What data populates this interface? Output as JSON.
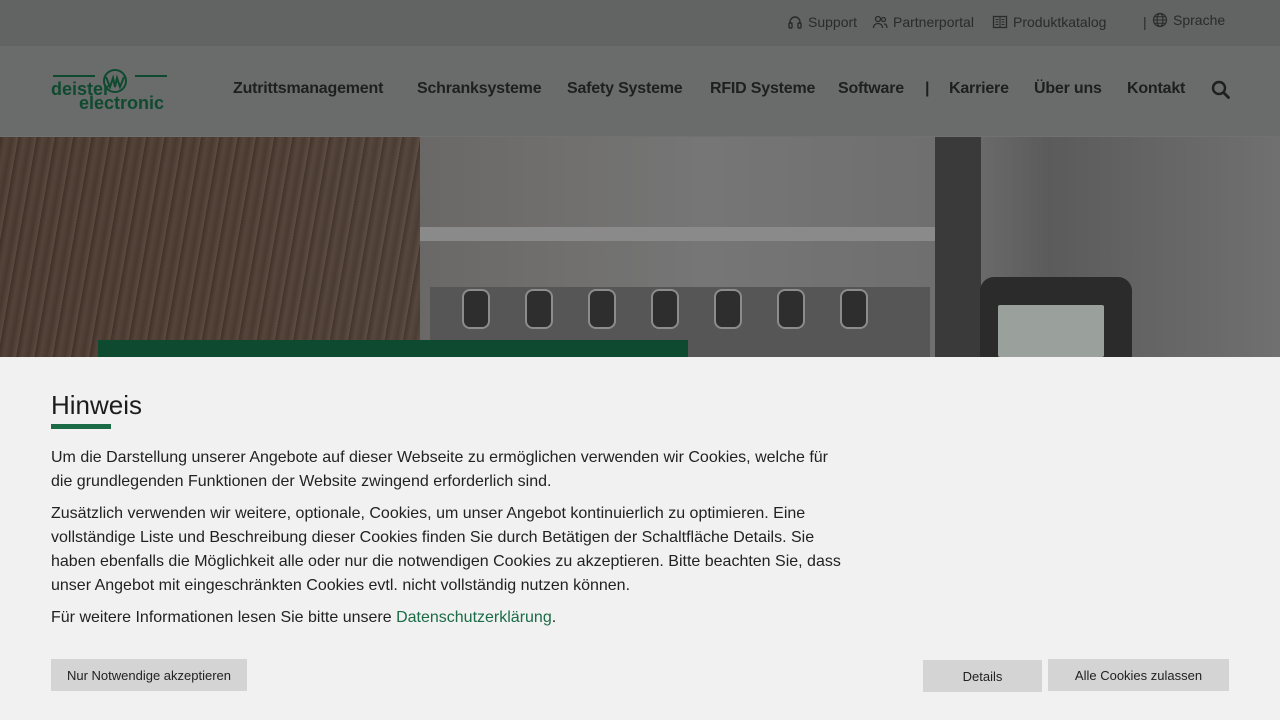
{
  "topbar": {
    "support": "Support",
    "partnerportal": "Partnerportal",
    "produktkatalog": "Produktkatalog",
    "separator": "|",
    "sprache": "Sprache"
  },
  "logo": {
    "line1": "deister",
    "line2": "electronic"
  },
  "nav": {
    "items": [
      "Zutrittsmanagement",
      "Schranksysteme",
      "Safety Systeme",
      "RFID Systeme",
      "Software",
      "Karriere",
      "Über uns",
      "Kontakt"
    ],
    "separator": "|"
  },
  "cookie": {
    "title": "Hinweis",
    "p1": "Um die Darstellung unserer Angebote auf dieser Webseite zu ermöglichen verwenden wir Cookies, welche für die grundlegenden Funktionen der Website zwingend erforderlich sind.",
    "p2": "Zusätzlich verwenden wir weitere, optionale, Cookies, um unser Angebot kontinuierlich zu optimieren. Eine vollständige Liste und Beschreibung dieser Cookies finden Sie durch Betätigen der Schaltfläche Details. Sie haben ebenfalls die Möglichkeit alle oder nur die notwendigen Cookies zu akzeptieren. Bitte beachten Sie, dass unser Angebot mit eingeschränkten Cookies evtl. nicht vollständig nutzen können.",
    "p3_prefix": "Für weitere Informationen lesen Sie bitte unsere ",
    "p3_link": "Datenschutzerklärung",
    "p3_suffix": ".",
    "btn_necessary": "Nur Notwendige akzeptieren",
    "btn_details": "Details",
    "btn_all": "Alle Cookies zulassen"
  },
  "colors": {
    "brand_green": "#1a6b46",
    "overlay": "#626363",
    "cookie_bg": "#f0f1f0"
  }
}
